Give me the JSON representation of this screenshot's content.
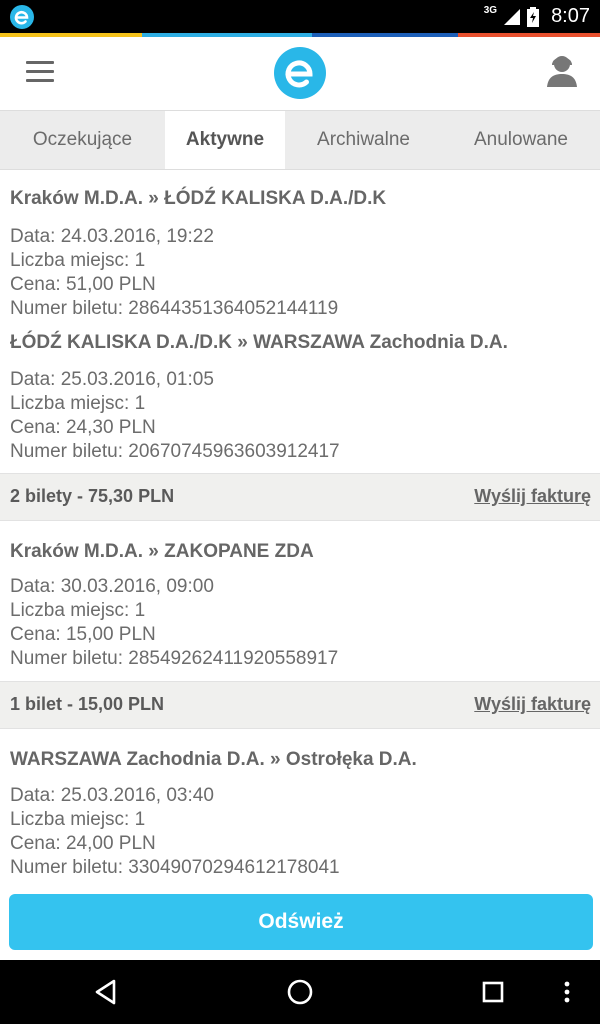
{
  "status_bar": {
    "network": "3G",
    "time": "8:07"
  },
  "header": {
    "logo": "e-podroznik-logo"
  },
  "tabs": [
    {
      "label": "Oczekujące"
    },
    {
      "label": "Aktywne"
    },
    {
      "label": "Archiwalne"
    },
    {
      "label": "Anulowane"
    }
  ],
  "orders": [
    {
      "tickets": [
        {
          "route": "Kraków  M.D.A. » ŁÓDŹ KALISKA D.A./D.K",
          "date": "Data: 24.03.2016, 19:22",
          "seats": "Liczba miejsc: 1",
          "price": "Cena: 51,00 PLN",
          "number": "Numer biletu: 28644351364052144119"
        },
        {
          "route": "ŁÓDŹ KALISKA D.A./D.K » WARSZAWA Zachodnia D.A.",
          "date": "Data: 25.03.2016, 01:05",
          "seats": "Liczba miejsc: 1",
          "price": "Cena: 24,30 PLN",
          "number": "Numer biletu: 20670745963603912417"
        }
      ],
      "summary": "2 bilety - 75,30 PLN",
      "invoice_label": "Wyślij fakturę"
    },
    {
      "tickets": [
        {
          "route": "Kraków  M.D.A. » ZAKOPANE ZDA",
          "date": "Data: 30.03.2016, 09:00",
          "seats": "Liczba miejsc: 1",
          "price": "Cena: 15,00 PLN",
          "number": "Numer biletu: 28549262411920558917"
        }
      ],
      "summary": "1 bilet - 15,00 PLN",
      "invoice_label": "Wyślij fakturę"
    },
    {
      "tickets": [
        {
          "route": "WARSZAWA Zachodnia D.A. » Ostrołęka D.A.",
          "date": "Data: 25.03.2016, 03:40",
          "seats": "Liczba miejsc: 1",
          "price": "Cena: 24,00 PLN",
          "number": "Numer biletu: 33049070294612178041"
        }
      ]
    }
  ],
  "refresh_label": "Odśwież",
  "colors": {
    "accent": "#34c3ef",
    "logo": "#29b7e8",
    "strip": [
      "#f5c21b",
      "#2eaee3",
      "#1d5fb8",
      "#e8502e"
    ]
  }
}
